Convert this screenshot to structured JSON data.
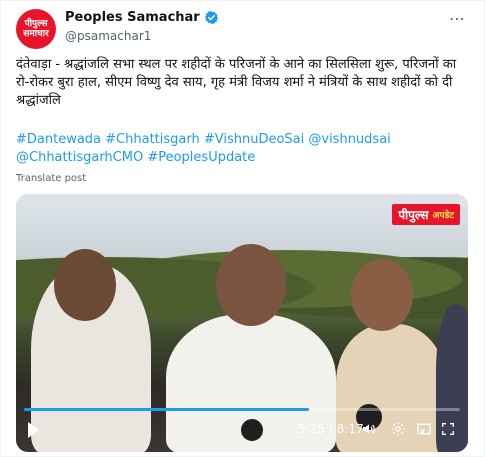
{
  "author": {
    "name": "Peoples Samachar",
    "handle": "@psamachar1",
    "avatar_text": [
      "पीपुल्स",
      "समाचार"
    ]
  },
  "post": {
    "text": "दंतेवाड़ा - श्रद्धांजलि सभा स्थल पर शहीदों के परिजनों के आने का सिलसिला शुरू, परिजनों का रो-रोकर बुरा हाल, सीएम विष्णु देव साय, गृह मंत्री विजय शर्मा ने मंत्रियों के साथ शहीदों को दी श्रद्धांजलि",
    "hashtags": "#Dantewada #Chhattisgarh #VishnuDeoSai @vishnudsai @ChhattisgarhCMO #PeoplesUpdate",
    "translate_label": "Translate post"
  },
  "video": {
    "badge_main": "पीपुल्स",
    "badge_sub": "अपडेट",
    "current_time": "5:25",
    "duration": "8:17",
    "progress_fraction": 0.654
  },
  "icons": {
    "more": "more-icon",
    "verified": "verified-icon",
    "play": "play-icon",
    "volume": "volume-icon",
    "settings": "gear-icon",
    "pip": "picture-in-picture-icon",
    "fullscreen": "fullscreen-icon"
  },
  "colors": {
    "link": "#1d9bf0",
    "brand_red": "#e8152a",
    "verified": "#1d9bf0"
  }
}
